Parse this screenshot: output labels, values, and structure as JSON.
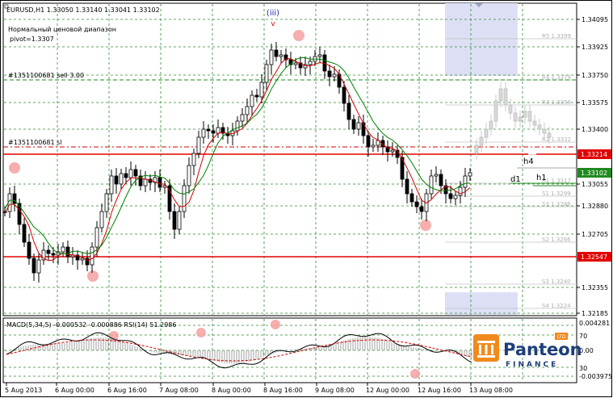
{
  "header": {
    "symbol_line": "EURUSD,H1  1.33050  1.33140  1.33041  1.33102",
    "indicator_name": "Нормальный ценовой диапазон",
    "pivot_label": "pivot=1.3307"
  },
  "wave_label": {
    "text": "(iii)",
    "marker": "v"
  },
  "order_labels": {
    "sell": "#1351100681 sell 3.00",
    "sl": "#1351100681 sl"
  },
  "timeframe_labels": {
    "h4": "h4",
    "d1": "d1",
    "h1": "h1"
  },
  "pivot_levels": [
    {
      "label": "R5",
      "value": "1.3399"
    },
    {
      "label": "R4",
      "value": "1.3374"
    },
    {
      "label": "R3",
      "value": "1.3356"
    },
    {
      "label": "R2",
      "value": "1.3332"
    },
    {
      "label": "R1",
      "value": "1.3317"
    },
    {
      "label": "S1",
      "value": "1.3299"
    },
    {
      "label": "S3",
      "value": "1.3288"
    },
    {
      "label": "S2",
      "value": "1.3266"
    },
    {
      "label": "S3",
      "value": "1.3240"
    },
    {
      "label": "S4",
      "value": "1.3224"
    }
  ],
  "price_axis": {
    "ticks": [
      "1.34095",
      "1.33925",
      "1.33750",
      "1.33575",
      "1.33400",
      "1.33055",
      "1.32880",
      "1.32705",
      "1.32355",
      "1.32185"
    ],
    "badges": [
      {
        "value": "1.33214",
        "color": "#e00000"
      },
      {
        "value": "1.33102",
        "color": "#1f8a1f"
      },
      {
        "value": "1.32547",
        "color": "#e00000"
      }
    ]
  },
  "macd": {
    "label": "MACD(5,34,5) -0.000532 -0.000886  RSI(14) 51.2986",
    "axis_ticks": [
      "0.004281",
      "70",
      "0.00",
      "30",
      "-0.003975"
    ]
  },
  "time_axis": {
    "labels": [
      "5 Aug 2013",
      "6 Aug 00:00",
      "6 Aug 16:00",
      "7 Aug 08:00",
      "8 Aug 00:00",
      "8 Aug 16:00",
      "9 Aug 08:00",
      "12 Aug 00:00",
      "12 Aug 16:00",
      "13 Aug 08:00"
    ]
  },
  "logo": {
    "brand": "Panteon",
    "sub": "FINANCE",
    "badge": "LTD"
  },
  "colors": {
    "red_level": "#e00000",
    "grid": "#2e8b2e",
    "candle": "#000000",
    "ma_fast": "#d00000",
    "ma_slow": "#008000",
    "highlight": "#f4a0a0",
    "future_box": "#dde0f5",
    "ghost_candles": "#c8c8c8",
    "logo_orange": "#f08a1c",
    "logo_blue": "#1d3e7a"
  }
}
